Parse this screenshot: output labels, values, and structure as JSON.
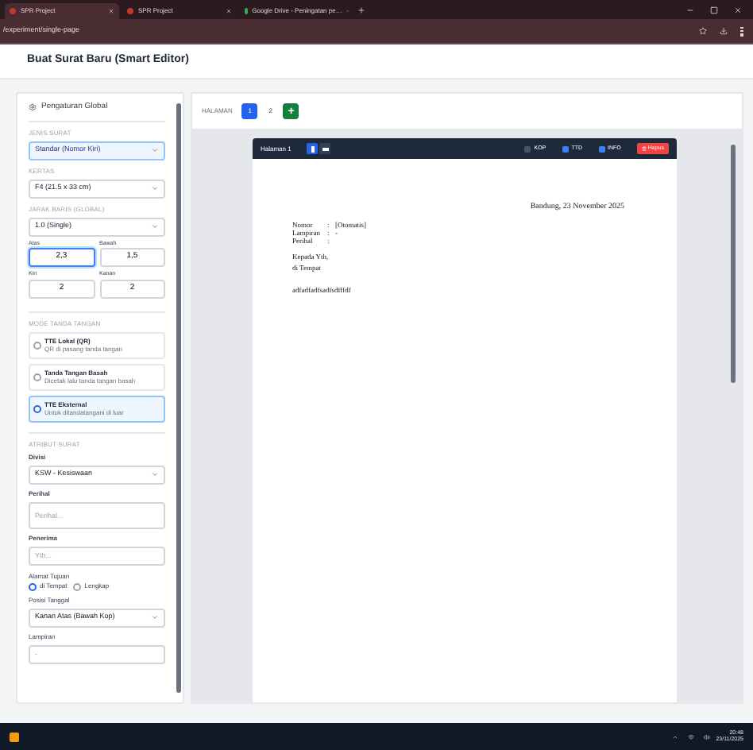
{
  "browser": {
    "tabs": [
      {
        "title": "SPR Project",
        "selected": true
      },
      {
        "title": "SPR Project",
        "selected": false
      },
      {
        "title": "Google Drive - Peningatan pe…",
        "selected": false
      }
    ],
    "address": "/experiment/single-page"
  },
  "page_title": "Buat Surat Baru (Smart Editor)",
  "settings": {
    "title": "Pengaturan Global",
    "jenis_surat": {
      "label": "JENIS SURAT",
      "value": "Standar (Nomor Kiri)"
    },
    "kertas": {
      "label": "KERTAS",
      "value": "F4 (21.5 x 33 cm)"
    },
    "jarak_baris": {
      "label": "JARAK BARIS (GLOBAL)",
      "value": "1.0 (Single)"
    },
    "margins": [
      {
        "label": "Atas",
        "value": "2,3",
        "focused": true
      },
      {
        "label": "Bawah",
        "value": "1,5",
        "focused": false
      },
      {
        "label": "Kiri",
        "value": "2",
        "focused": false
      },
      {
        "label": "Kanan",
        "value": "2",
        "focused": false
      }
    ],
    "signature_mode": {
      "label": "MODE TANDA TANGAN",
      "options": [
        {
          "title": "TTE Lokal (QR)",
          "desc": "QR di pasang tanda tangan",
          "selected": false
        },
        {
          "title": "Tanda Tangan Basah",
          "desc": "Dicetak lalu tanda tangan basah",
          "selected": false
        },
        {
          "title": "TTE Eksternal",
          "desc": "Untuk ditandatangani di luar",
          "selected": true
        }
      ]
    },
    "attributes_label": "ATRIBUT SURAT",
    "divisi": {
      "label": "Divisi",
      "value": "KSW - Kesiswaan"
    },
    "perihal": {
      "label": "Perihal",
      "placeholder": "Perihal..."
    },
    "penerima": {
      "label": "Penerima",
      "placeholder": "Yth..."
    },
    "alamat": {
      "label": "Alamat Tujuan",
      "options": [
        {
          "label": "di Tempat",
          "selected": true
        },
        {
          "label": "Lengkap",
          "selected": false
        }
      ]
    },
    "posisi_tanggal": {
      "label": "Posisi Tanggal",
      "value": "Kanan Atas (Bawah Kop)"
    },
    "lampiran": {
      "label": "Lampiran",
      "placeholder": "-"
    }
  },
  "pages_bar": {
    "label": "HALAMAN",
    "pages": [
      {
        "label": "1",
        "selected": true
      },
      {
        "label": "2",
        "selected": false
      }
    ],
    "add": "+"
  },
  "doc_toolbar": {
    "title": "Halaman 1",
    "orientation": [
      {
        "kind": "portrait",
        "selected": true
      },
      {
        "kind": "landscape",
        "selected": false
      }
    ],
    "toggles": [
      {
        "label": "KOP",
        "checked": false
      },
      {
        "label": "TTD",
        "checked": true
      },
      {
        "label": "INFO",
        "checked": true
      }
    ],
    "delete": "Hapus"
  },
  "letter": {
    "date": "Bandung, 23 November 2025",
    "fields": [
      {
        "label": "Nomor",
        "sep": ":",
        "value": "[Otomatis]"
      },
      {
        "label": "Lampiran",
        "sep": ":",
        "value": "-"
      },
      {
        "label": "Perihal",
        "sep": ":"
      }
    ],
    "recipient": [
      "Kepada Yth,",
      "di Tempat"
    ],
    "body": "adfadfadfsadfsdfffdf"
  },
  "taskbar": {
    "time": "20:48",
    "date": "23/11/2025"
  }
}
